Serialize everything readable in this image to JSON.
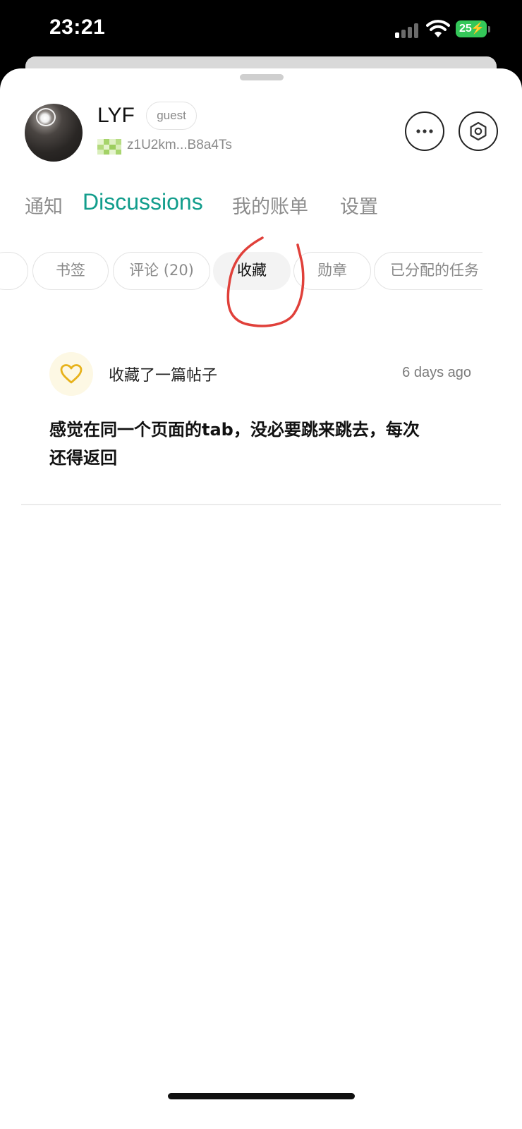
{
  "status_bar": {
    "time": "23:21",
    "battery": "25",
    "battery_color": "#34c759",
    "icons": [
      "signal-icon",
      "wifi-icon",
      "battery-icon"
    ]
  },
  "profile": {
    "name": "LYF",
    "role_badge": "guest",
    "wallet_address": "z1U2km...B8a4Ts",
    "actions": [
      "more-icon",
      "settings-icon"
    ]
  },
  "main_tabs": [
    {
      "label": "通知",
      "active": false
    },
    {
      "label": "Discussions",
      "active": true
    },
    {
      "label": "我的账单",
      "active": false
    },
    {
      "label": "设置",
      "active": false
    }
  ],
  "sub_tabs": [
    {
      "label": "书签",
      "active": false
    },
    {
      "label": "评论 (20)",
      "active": false
    },
    {
      "label": "收藏",
      "active": true
    },
    {
      "label": "勋章",
      "active": false
    },
    {
      "label": "已分配的任务",
      "active": false
    }
  ],
  "activity": {
    "icon": "heart-icon",
    "label": "收藏了一篇帖子",
    "time": "6 days ago",
    "content": "感觉在同一个页面的tab，没必要跳来跳去，每次还得返回"
  },
  "colors": {
    "accent": "#129d8c",
    "annotation": "#e0403a",
    "heart": "#e7b21b"
  }
}
